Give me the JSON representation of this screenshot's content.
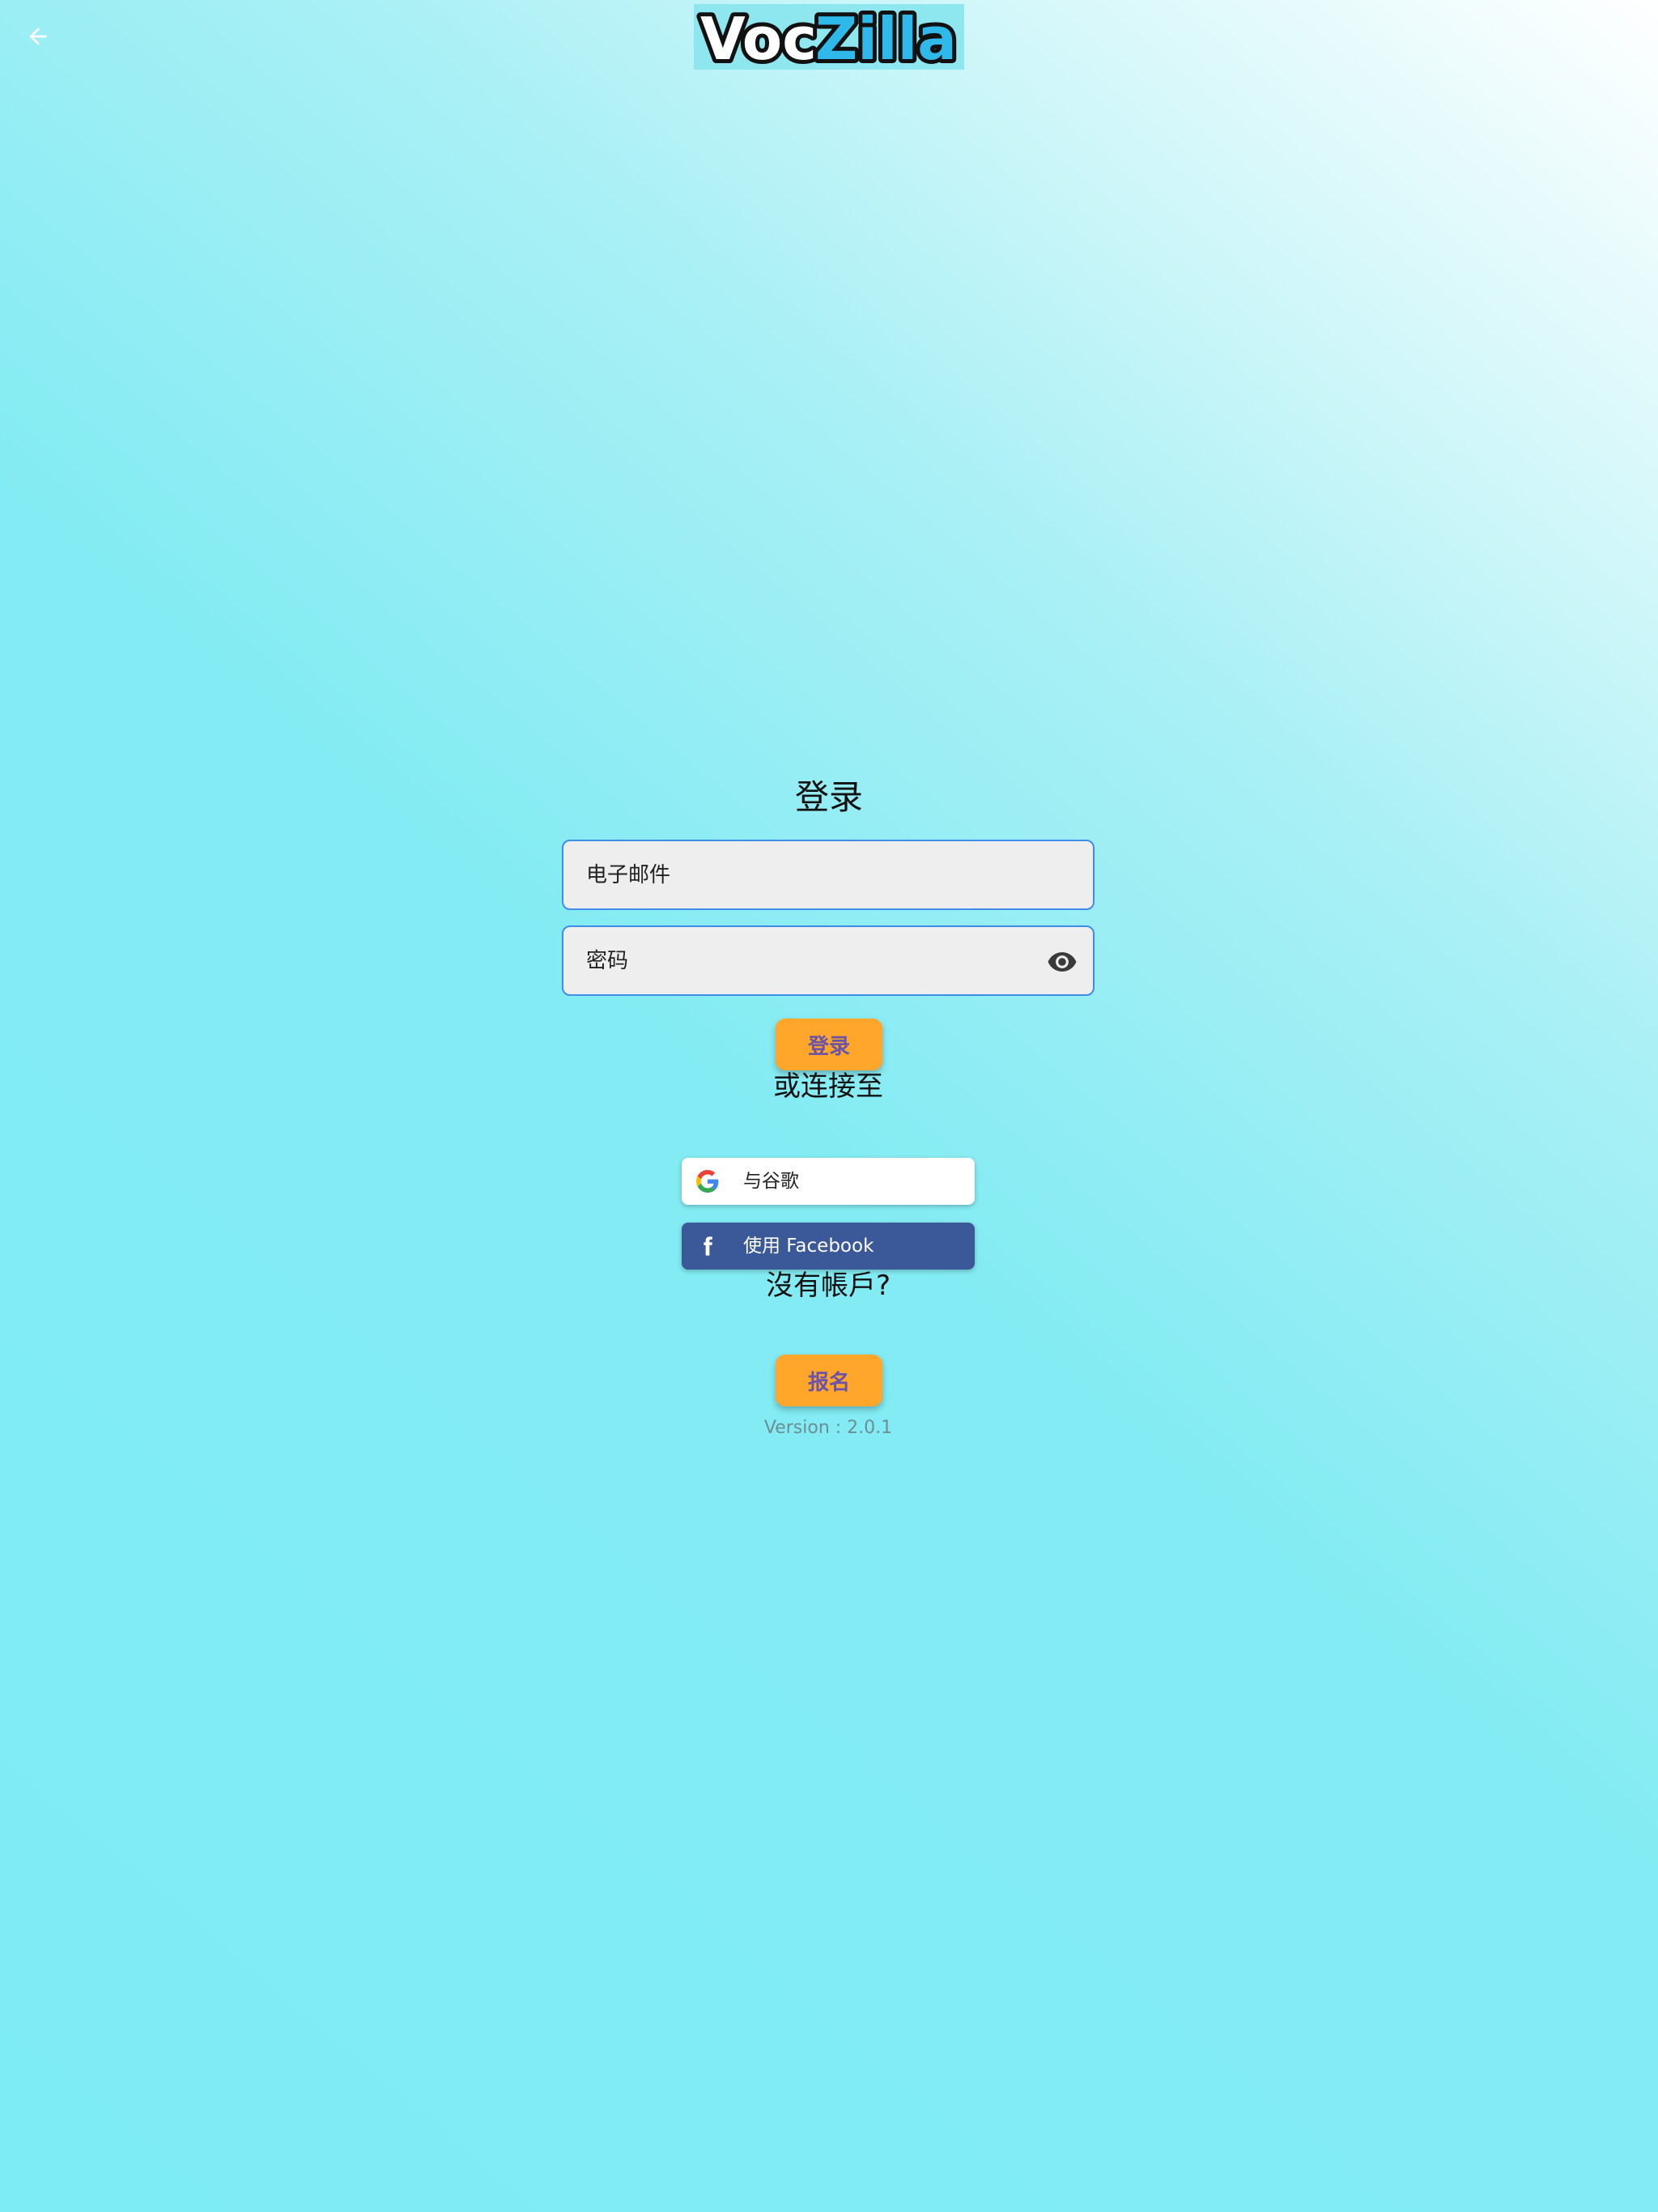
{
  "app": {
    "logo_text": "VocZilla",
    "logo_part1": "Voc",
    "logo_part2": "Zilla"
  },
  "header": {
    "back_icon": "arrow-left-icon"
  },
  "login": {
    "title": "登录",
    "email_placeholder": "电子邮件",
    "password_placeholder": "密码",
    "password_toggle_icon": "eye-icon",
    "submit_label": "登录",
    "or_connect": "或连接至",
    "google_label": "与谷歌",
    "google_icon": "google-g-icon",
    "facebook_label": "使用 Facebook",
    "facebook_icon": "facebook-f-icon",
    "no_account": "沒有帳戶?",
    "signup_label": "报名",
    "version": "Version : 2.0.1"
  },
  "colors": {
    "accent_button": "#ffa62b",
    "button_text": "#6a53a8",
    "facebook_blue": "#3b5998",
    "field_border": "#3f8de8",
    "logo_blue": "#2fb9ea"
  }
}
